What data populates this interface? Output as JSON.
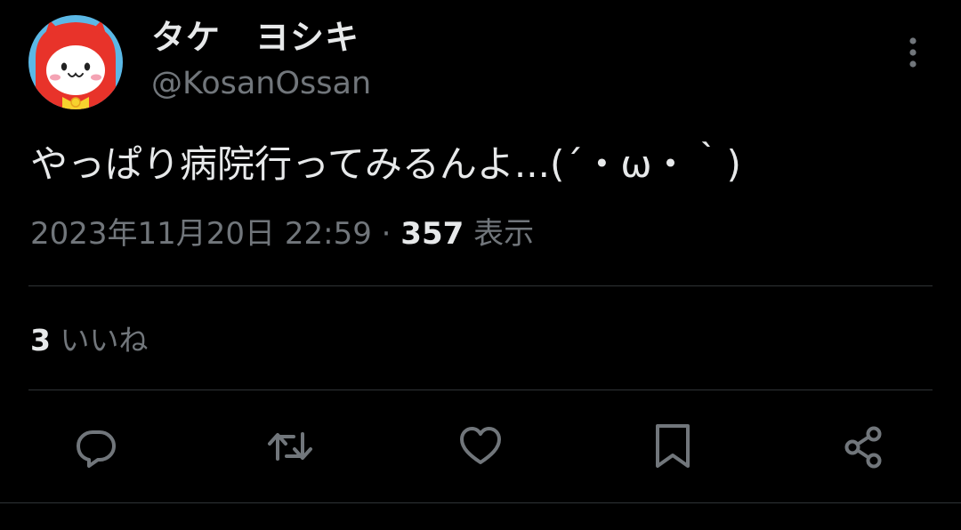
{
  "user": {
    "display_name": "タケ　ヨシキ",
    "handle": "@KosanOssan"
  },
  "tweet": {
    "text": "やっぱり病院行ってみるんよ...(´・ω・｀)",
    "timestamp": "2023年11月20日 22:59",
    "separator": " · ",
    "views_count": "357",
    "views_label": " 表示"
  },
  "stats": {
    "likes_count": "3",
    "likes_label": " いいね"
  },
  "actions": {
    "reply_icon": "reply-icon",
    "retweet_icon": "retweet-icon",
    "like_icon": "heart-icon",
    "bookmark_icon": "bookmark-icon",
    "share_icon": "share-icon"
  },
  "colors": {
    "background": "#000000",
    "text_primary": "#e7e9ea",
    "text_secondary": "#71767b",
    "divider": "#2f3336",
    "avatar_red": "#e8332a"
  }
}
